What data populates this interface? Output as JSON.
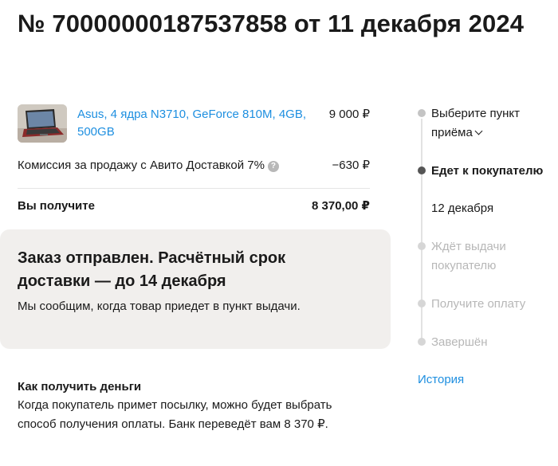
{
  "order": {
    "title": "№ 70000000187537858 от 11 декабря 2024"
  },
  "item": {
    "name": "Asus, 4 ядра N3710, GeForce 810M, 4GB, 500GB",
    "price": "9 000 ₽"
  },
  "fee": {
    "label": "Комиссия за продажу с Авито Доставкой 7%",
    "amount": "−630 ₽",
    "help_icon": "?"
  },
  "net": {
    "label": "Вы получите",
    "amount": "8 370,00 ₽"
  },
  "status_card": {
    "heading": "Заказ отправлен. Расчётный срок доставки — до 14 декабря",
    "text": "Мы сообщим, когда товар приедет в пункт выдачи."
  },
  "money": {
    "heading": "Как получить деньги",
    "text": "Когда покупатель примет посылку, можно будет выбрать способ получения оплаты. Банк переведёт вам 8 370 ₽."
  },
  "timeline": {
    "steps": [
      {
        "label": "Выберите пункт приёма",
        "state": "done"
      },
      {
        "label": "Едет к покупателю",
        "date": "12 декабря",
        "state": "current"
      },
      {
        "label": "Ждёт выдачи покупателю",
        "state": "pending"
      },
      {
        "label": "Получите оплату",
        "state": "pending"
      },
      {
        "label": "Завершён",
        "state": "pending"
      }
    ],
    "history_link": "История"
  },
  "colors": {
    "link": "#1e8fe0",
    "card_bg": "#f1efed",
    "muted": "#b7b7b7",
    "active_dot": "#555555"
  }
}
